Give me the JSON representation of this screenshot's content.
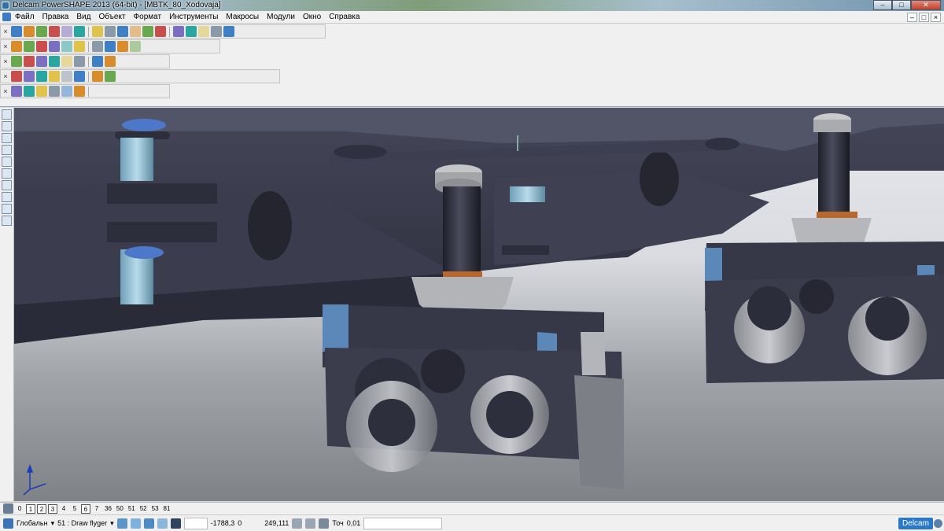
{
  "window": {
    "title": "Delcam PowerSHAPE 2013 (64-bit) - [MBTK_80_Xodovaja]",
    "controls": [
      "minimize",
      "maximize",
      "close"
    ]
  },
  "menu": {
    "items": [
      "Файл",
      "Правка",
      "Вид",
      "Объект",
      "Формат",
      "Инструменты",
      "Макросы",
      "Модули",
      "Окно",
      "Справка"
    ]
  },
  "toolbars": {
    "row1": [
      "undo-icon",
      "redo-icon",
      "new-icon",
      "open-icon",
      "save-icon",
      "print-icon",
      "cut-icon",
      "copy-icon",
      "paste-icon",
      "select-icon",
      "point-icon",
      "circle-icon",
      "line-icon",
      "surface-icon",
      "solid-icon",
      "wireframe-icon",
      "measure-icon"
    ],
    "row2": [
      "view-top-icon",
      "view-front-icon",
      "view-side-icon",
      "view-iso-icon",
      "zoom-in-icon",
      "zoom-out-icon",
      "zoom-box-icon",
      "zoom-all-icon",
      "shade-icon",
      "render-icon"
    ],
    "row3": [
      "hide-icon",
      "show-icon",
      "layer-icon",
      "group-icon",
      "material-icon",
      "color-icon",
      "texture-icon",
      "light-icon"
    ],
    "row4": [
      "solid-box-icon",
      "solid-cyl-icon",
      "solid-sphere-icon",
      "solid-cone-icon",
      "boolean-icon",
      "fillet-icon",
      "chamfer-icon",
      "shell-icon"
    ],
    "row5": [
      "feature-icon",
      "extrude-icon",
      "revolve-icon",
      "sweep-icon",
      "loft-icon",
      "blend-icon"
    ]
  },
  "viewport": {
    "model_name": "MBTK_80_Xodovaja",
    "background_top": "#e7e9ed",
    "background_bottom": "#7f8287",
    "frame_color": "#3c3e4f",
    "triad_color": "#1a3eb8"
  },
  "levels": {
    "items": [
      "0",
      "1",
      "2",
      "3",
      "4",
      "5",
      "6",
      "7",
      "36",
      "50",
      "51",
      "52",
      "53",
      "81"
    ],
    "selected": [
      "1",
      "2",
      "3",
      "6"
    ]
  },
  "status": {
    "workplane": "Глобальн",
    "level_label": "51 : Draw flyger",
    "x": "-1788,3",
    "y": "0",
    "z": "249,111",
    "tolerance_label": "Точ",
    "tolerance": "0,01",
    "brand": "Delcam"
  }
}
